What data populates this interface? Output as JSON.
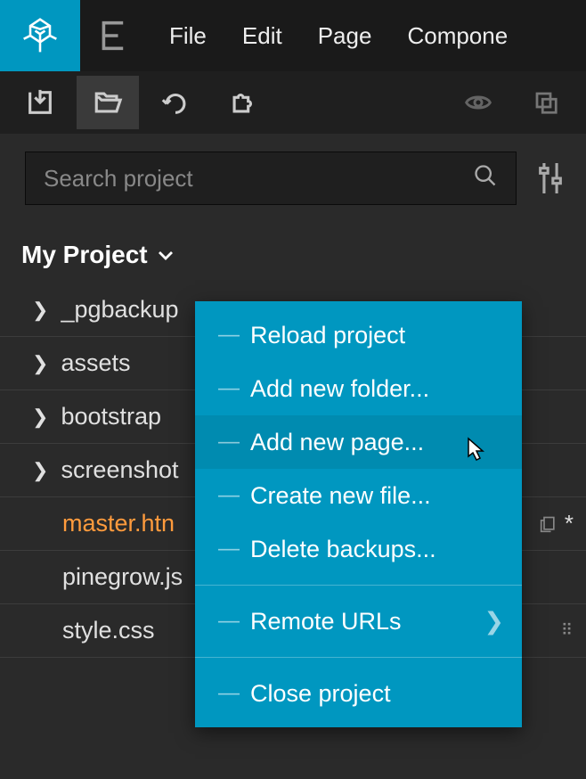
{
  "menu": {
    "file": "File",
    "edit": "Edit",
    "page": "Page",
    "component": "Compone"
  },
  "search": {
    "placeholder": "Search project"
  },
  "project": {
    "title": "My Project"
  },
  "tree": {
    "folders": [
      {
        "name": "_pgbackup"
      },
      {
        "name": "assets"
      },
      {
        "name": "bootstrap"
      },
      {
        "name": "screenshot"
      }
    ],
    "files": [
      {
        "name": "master.htn",
        "highlight": true,
        "asterisk": "*"
      },
      {
        "name": "pinegrow.js"
      },
      {
        "name": "style.css"
      }
    ]
  },
  "context_menu": {
    "reload": "Reload project",
    "add_folder": "Add new folder...",
    "add_page": "Add new page...",
    "create_file": "Create new file...",
    "delete_backups": "Delete backups...",
    "remote_urls": "Remote URLs",
    "close": "Close project"
  }
}
